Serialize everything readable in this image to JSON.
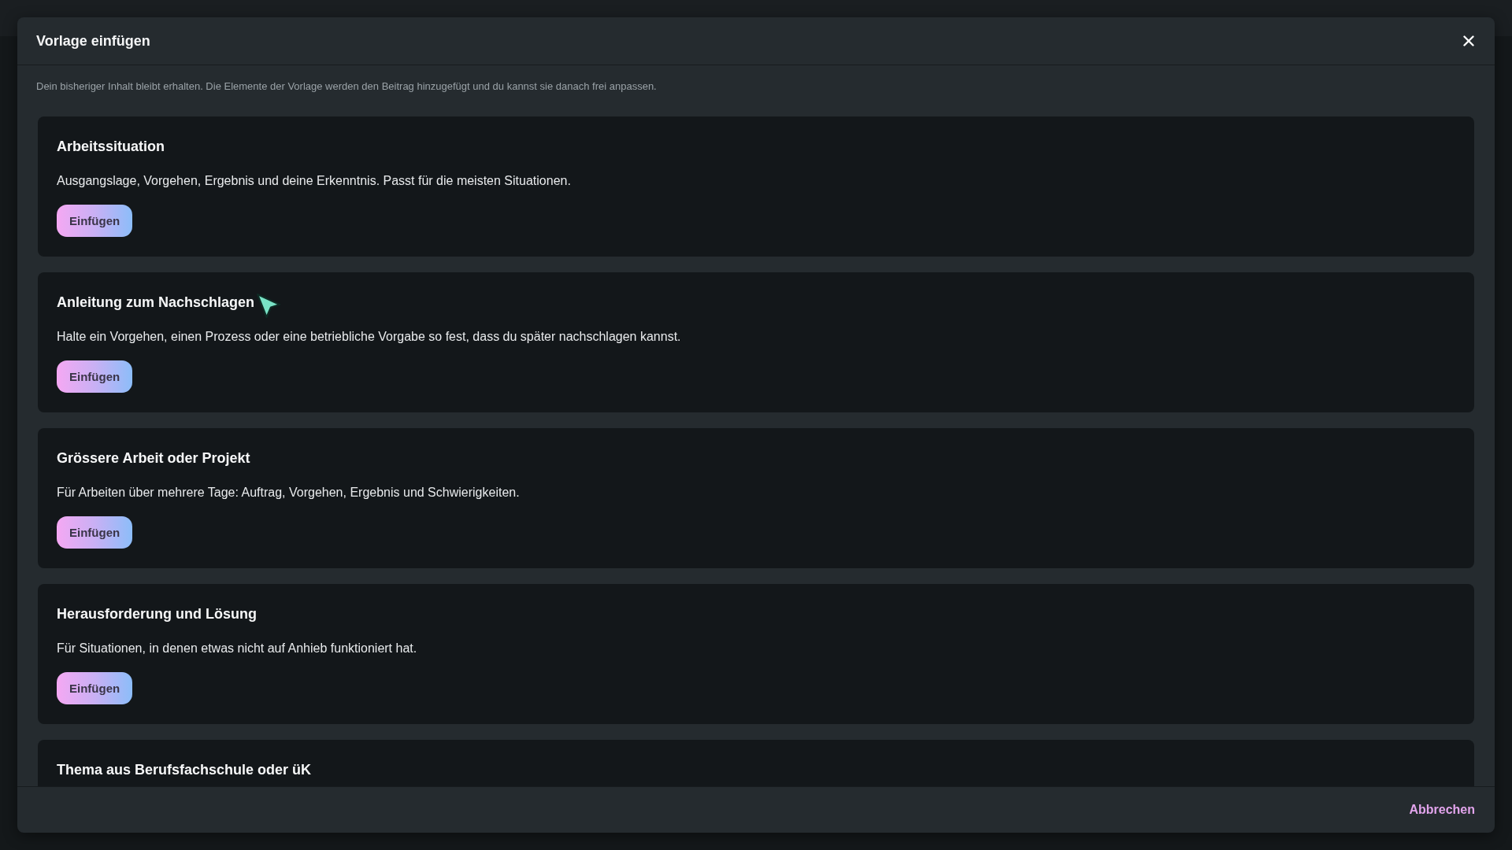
{
  "dialog": {
    "title": "Vorlage einfügen",
    "description": "Dein bisheriger Inhalt bleibt erhalten. Die Elemente der Vorlage werden den Beitrag hinzugefügt und du kannst sie danach frei anpassen.",
    "templates": [
      {
        "title": "Arbeitssituation",
        "description": "Ausgangslage, Vorgehen, Ergebnis und deine Erkenntnis. Passt für die meisten Situationen.",
        "button": "Einfügen"
      },
      {
        "title": "Anleitung zum Nachschlagen",
        "description": "Halte ein Vorgehen, einen Prozess oder eine betriebliche Vorgabe so fest, dass du später nachschlagen kannst.",
        "button": "Einfügen"
      },
      {
        "title": "Grössere Arbeit oder Projekt",
        "description": "Für Arbeiten über mehrere Tage: Auftrag, Vorgehen, Ergebnis und Schwierigkeiten.",
        "button": "Einfügen"
      },
      {
        "title": "Herausforderung und Lösung",
        "description": "Für Situationen, in denen etwas nicht auf Anhieb funktioniert hat.",
        "button": "Einfügen"
      },
      {
        "title": "Thema aus Berufsfachschule oder üK"
      }
    ],
    "footer": {
      "cancel": "Abbrechen"
    }
  }
}
